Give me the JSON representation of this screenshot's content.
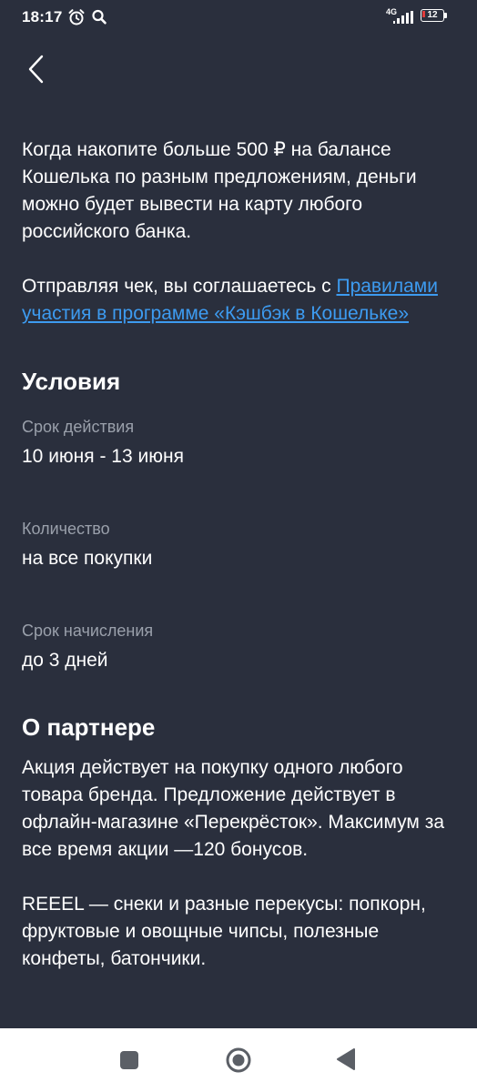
{
  "status_bar": {
    "time": "18:17",
    "network": "4G",
    "battery": "12",
    "icons": [
      "alarm-icon",
      "search-icon",
      "signal-icon",
      "battery-icon"
    ]
  },
  "header": {
    "back_icon": "chevron-left-icon"
  },
  "intro": {
    "paragraph1": "Когда накопите больше 500 ₽ на балансе Кошелька по разным предложениям, деньги можно будет вывести на карту любого российского банка.",
    "paragraph2_prefix": "Отправляя чек, вы соглашаетесь с ",
    "rules_link": "Правилами участия в программе «Кэшбэк в Кошельке»"
  },
  "conditions": {
    "title": "Условия",
    "items": [
      {
        "label": "Срок действия",
        "value": "10 июня - 13 июня"
      },
      {
        "label": "Количество",
        "value": "на все покупки"
      },
      {
        "label": "Срок начисления",
        "value": "до 3 дней"
      }
    ]
  },
  "partner": {
    "title": "О партнере",
    "paragraph1": "Акция действует на покупку одного любого товара бренда. Предложение действует в офлайн-магазине «Перекрёсток». Максимум за все время акции —120 бонусов.",
    "paragraph2": "REEEL — снеки и разные перекусы: попкорн, фруктовые и овощные чипсы, полезные конфеты, батончики."
  },
  "navigation": {
    "icons": [
      "recent-apps-icon",
      "home-icon",
      "back-triangle-icon"
    ]
  },
  "colors": {
    "background": "#2a2f3d",
    "text": "#ffffff",
    "muted": "#9aa0ab",
    "link": "#3d9bf0",
    "nav_bar": "#ffffff"
  }
}
